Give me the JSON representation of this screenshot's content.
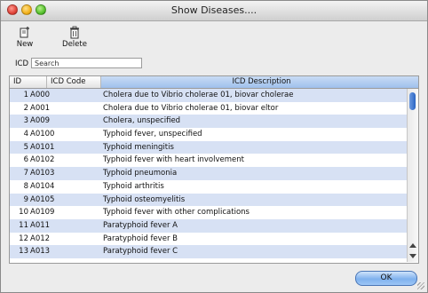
{
  "window": {
    "title": "Show Diseases...."
  },
  "toolbar": {
    "new_label": "New",
    "delete_label": "Delete",
    "new_icon": "new-doc-icon",
    "delete_icon": "trash-icon"
  },
  "search": {
    "label": "ICD",
    "value": "Search"
  },
  "table": {
    "headers": {
      "id": "ID",
      "code": "ICD Code",
      "desc": "ICD Description"
    },
    "rows": [
      {
        "id": "1",
        "code": "A000",
        "desc": "Cholera due to Vibrio cholerae 01, biovar cholerae"
      },
      {
        "id": "2",
        "code": "A001",
        "desc": "Cholera due to Vibrio cholerae 01, biovar eltor"
      },
      {
        "id": "3",
        "code": "A009",
        "desc": "Cholera, unspecified"
      },
      {
        "id": "4",
        "code": "A0100",
        "desc": "Typhoid fever, unspecified"
      },
      {
        "id": "5",
        "code": "A0101",
        "desc": "Typhoid meningitis"
      },
      {
        "id": "6",
        "code": "A0102",
        "desc": "Typhoid fever with heart involvement"
      },
      {
        "id": "7",
        "code": "A0103",
        "desc": "Typhoid pneumonia"
      },
      {
        "id": "8",
        "code": "A0104",
        "desc": "Typhoid arthritis"
      },
      {
        "id": "9",
        "code": "A0105",
        "desc": "Typhoid osteomyelitis"
      },
      {
        "id": "10",
        "code": "A0109",
        "desc": "Typhoid fever with other complications"
      },
      {
        "id": "11",
        "code": "A011",
        "desc": "Paratyphoid fever A"
      },
      {
        "id": "12",
        "code": "A012",
        "desc": "Paratyphoid fever B"
      },
      {
        "id": "13",
        "code": "A013",
        "desc": "Paratyphoid fever C"
      }
    ]
  },
  "footer": {
    "ok_label": "OK"
  },
  "colors": {
    "row_alt": "#d7e1f4",
    "header_selected": "#9fc0ec",
    "accent": "#2a64c4"
  }
}
